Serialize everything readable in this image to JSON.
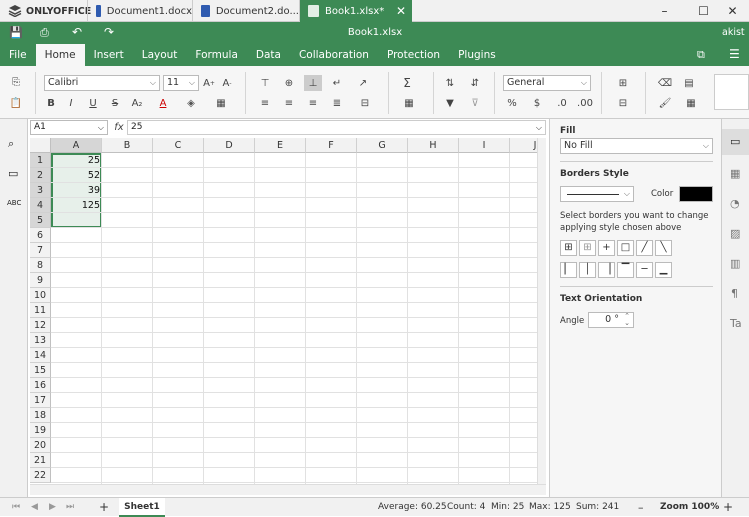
{
  "app": {
    "logo": "ONLYOFFICE",
    "title": "Book1.xlsx",
    "user": "akist"
  },
  "tabs": [
    {
      "label": "Document1.docx",
      "color": "#2f5bb0"
    },
    {
      "label": "Document2.do...",
      "color": "#2f5bb0"
    },
    {
      "label": "Book1.xlsx*",
      "color": "#3d8a55"
    }
  ],
  "window": {
    "minimize": "–",
    "maximize": "☐",
    "close": "✕"
  },
  "menu": [
    "File",
    "Home",
    "Insert",
    "Layout",
    "Formula",
    "Data",
    "Collaboration",
    "Protection",
    "Plugins"
  ],
  "toolbar": {
    "font_name": "Calibri",
    "font_size": "11",
    "number_format": "General"
  },
  "formula": {
    "cell": "A1",
    "fx": "fx",
    "value": "25"
  },
  "columns": [
    "A",
    "B",
    "C",
    "D",
    "E",
    "F",
    "G",
    "H",
    "I",
    "J"
  ],
  "rows": [
    "1",
    "2",
    "3",
    "4",
    "5",
    "6",
    "7",
    "8",
    "9",
    "10",
    "11",
    "12",
    "13",
    "14",
    "15",
    "16",
    "17",
    "18",
    "19",
    "20",
    "21",
    "22"
  ],
  "cells": {
    "A1": "25",
    "A2": "52",
    "A3": "39",
    "A4": "125"
  },
  "right_panel": {
    "fill_label": "Fill",
    "fill_value": "No Fill",
    "borders_label": "Borders Style",
    "color_label": "Color",
    "borders_hint": "Select borders you want to change applying style chosen above",
    "text_orientation_label": "Text Orientation",
    "angle_label": "Angle",
    "angle_value": "0 °",
    "border_color": "#000000"
  },
  "status": {
    "sheet": "Sheet1",
    "average": "Average: 60.25",
    "count": "Count: 4",
    "min": "Min: 25",
    "max": "Max: 125",
    "sum": "Sum: 241",
    "zoom": "Zoom 100%",
    "zoom_out": "–",
    "zoom_in": "+",
    "add_sheet": "+"
  }
}
